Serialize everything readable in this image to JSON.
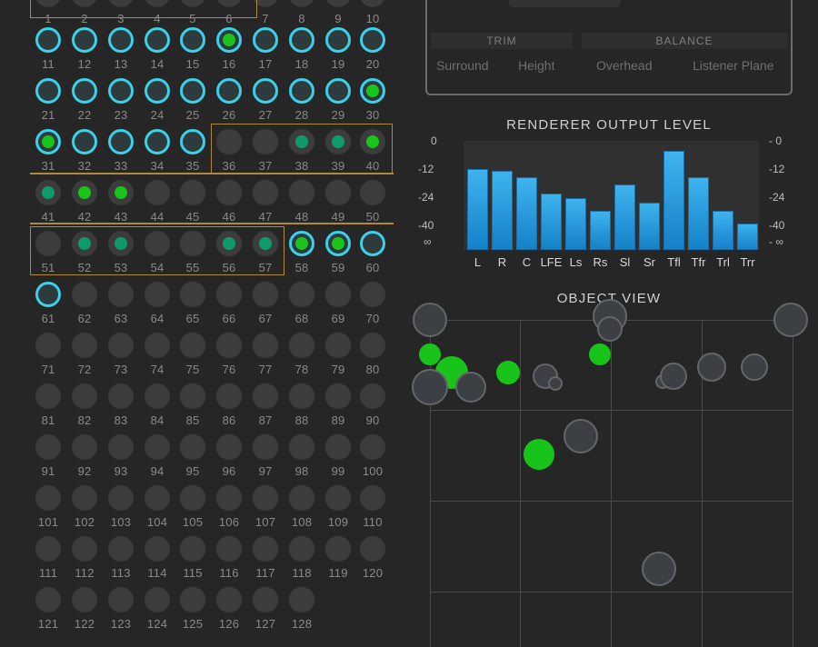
{
  "objects": [
    {
      "n": "1",
      "state": "gray"
    },
    {
      "n": "2",
      "state": "gray"
    },
    {
      "n": "3",
      "state": "gray"
    },
    {
      "n": "4",
      "state": "gray"
    },
    {
      "n": "5",
      "state": "gray"
    },
    {
      "n": "6",
      "state": "gray"
    },
    {
      "n": "7",
      "state": "gray"
    },
    {
      "n": "8",
      "state": "gray"
    },
    {
      "n": "9",
      "state": "gray"
    },
    {
      "n": "10",
      "state": "gray"
    },
    {
      "n": "11",
      "state": "cyan"
    },
    {
      "n": "12",
      "state": "cyan"
    },
    {
      "n": "13",
      "state": "cyan"
    },
    {
      "n": "14",
      "state": "cyan"
    },
    {
      "n": "15",
      "state": "cyan"
    },
    {
      "n": "16",
      "state": "cyan-green"
    },
    {
      "n": "17",
      "state": "cyan"
    },
    {
      "n": "18",
      "state": "cyan"
    },
    {
      "n": "19",
      "state": "cyan"
    },
    {
      "n": "20",
      "state": "cyan"
    },
    {
      "n": "21",
      "state": "cyan"
    },
    {
      "n": "22",
      "state": "cyan"
    },
    {
      "n": "23",
      "state": "cyan"
    },
    {
      "n": "24",
      "state": "cyan"
    },
    {
      "n": "25",
      "state": "cyan"
    },
    {
      "n": "26",
      "state": "cyan"
    },
    {
      "n": "27",
      "state": "cyan"
    },
    {
      "n": "28",
      "state": "cyan"
    },
    {
      "n": "29",
      "state": "cyan"
    },
    {
      "n": "30",
      "state": "cyan-green"
    },
    {
      "n": "31",
      "state": "cyan-green"
    },
    {
      "n": "32",
      "state": "cyan"
    },
    {
      "n": "33",
      "state": "cyan"
    },
    {
      "n": "34",
      "state": "cyan"
    },
    {
      "n": "35",
      "state": "cyan"
    },
    {
      "n": "36",
      "state": "gray"
    },
    {
      "n": "37",
      "state": "gray"
    },
    {
      "n": "38",
      "state": "teal"
    },
    {
      "n": "39",
      "state": "teal"
    },
    {
      "n": "40",
      "state": "green"
    },
    {
      "n": "41",
      "state": "teal"
    },
    {
      "n": "42",
      "state": "green"
    },
    {
      "n": "43",
      "state": "green"
    },
    {
      "n": "44",
      "state": "gray"
    },
    {
      "n": "45",
      "state": "gray"
    },
    {
      "n": "46",
      "state": "gray"
    },
    {
      "n": "47",
      "state": "gray"
    },
    {
      "n": "48",
      "state": "gray"
    },
    {
      "n": "49",
      "state": "gray"
    },
    {
      "n": "50",
      "state": "gray"
    },
    {
      "n": "51",
      "state": "gray"
    },
    {
      "n": "52",
      "state": "teal"
    },
    {
      "n": "53",
      "state": "teal"
    },
    {
      "n": "54",
      "state": "gray"
    },
    {
      "n": "55",
      "state": "gray"
    },
    {
      "n": "56",
      "state": "teal"
    },
    {
      "n": "57",
      "state": "teal"
    },
    {
      "n": "58",
      "state": "cyan-green"
    },
    {
      "n": "59",
      "state": "cyan-green"
    },
    {
      "n": "60",
      "state": "cyan"
    },
    {
      "n": "61",
      "state": "cyan"
    },
    {
      "n": "62",
      "state": "gray"
    },
    {
      "n": "63",
      "state": "gray"
    },
    {
      "n": "64",
      "state": "gray"
    },
    {
      "n": "65",
      "state": "gray"
    },
    {
      "n": "66",
      "state": "gray"
    },
    {
      "n": "67",
      "state": "gray"
    },
    {
      "n": "68",
      "state": "gray"
    },
    {
      "n": "69",
      "state": "gray"
    },
    {
      "n": "70",
      "state": "gray"
    },
    {
      "n": "71",
      "state": "gray"
    },
    {
      "n": "72",
      "state": "gray"
    },
    {
      "n": "73",
      "state": "gray"
    },
    {
      "n": "74",
      "state": "gray"
    },
    {
      "n": "75",
      "state": "gray"
    },
    {
      "n": "76",
      "state": "gray"
    },
    {
      "n": "77",
      "state": "gray"
    },
    {
      "n": "78",
      "state": "gray"
    },
    {
      "n": "79",
      "state": "gray"
    },
    {
      "n": "80",
      "state": "gray"
    },
    {
      "n": "81",
      "state": "gray"
    },
    {
      "n": "82",
      "state": "gray"
    },
    {
      "n": "83",
      "state": "gray"
    },
    {
      "n": "84",
      "state": "gray"
    },
    {
      "n": "85",
      "state": "gray"
    },
    {
      "n": "86",
      "state": "gray"
    },
    {
      "n": "87",
      "state": "gray"
    },
    {
      "n": "88",
      "state": "gray"
    },
    {
      "n": "89",
      "state": "gray"
    },
    {
      "n": "90",
      "state": "gray"
    },
    {
      "n": "91",
      "state": "gray"
    },
    {
      "n": "92",
      "state": "gray"
    },
    {
      "n": "93",
      "state": "gray"
    },
    {
      "n": "94",
      "state": "gray"
    },
    {
      "n": "95",
      "state": "gray"
    },
    {
      "n": "96",
      "state": "gray"
    },
    {
      "n": "97",
      "state": "gray"
    },
    {
      "n": "98",
      "state": "gray"
    },
    {
      "n": "99",
      "state": "gray"
    },
    {
      "n": "100",
      "state": "gray"
    },
    {
      "n": "101",
      "state": "gray"
    },
    {
      "n": "102",
      "state": "gray"
    },
    {
      "n": "103",
      "state": "gray"
    },
    {
      "n": "104",
      "state": "gray"
    },
    {
      "n": "105",
      "state": "gray"
    },
    {
      "n": "106",
      "state": "gray"
    },
    {
      "n": "107",
      "state": "gray"
    },
    {
      "n": "108",
      "state": "gray"
    },
    {
      "n": "109",
      "state": "gray"
    },
    {
      "n": "110",
      "state": "gray"
    },
    {
      "n": "111",
      "state": "gray"
    },
    {
      "n": "112",
      "state": "gray"
    },
    {
      "n": "113",
      "state": "gray"
    },
    {
      "n": "114",
      "state": "gray"
    },
    {
      "n": "115",
      "state": "gray"
    },
    {
      "n": "116",
      "state": "gray"
    },
    {
      "n": "117",
      "state": "gray"
    },
    {
      "n": "118",
      "state": "gray"
    },
    {
      "n": "119",
      "state": "gray"
    },
    {
      "n": "120",
      "state": "gray"
    },
    {
      "n": "121",
      "state": "gray"
    },
    {
      "n": "122",
      "state": "gray"
    },
    {
      "n": "123",
      "state": "gray"
    },
    {
      "n": "124",
      "state": "gray"
    },
    {
      "n": "125",
      "state": "gray"
    },
    {
      "n": "126",
      "state": "gray"
    },
    {
      "n": "127",
      "state": "gray"
    },
    {
      "n": "128",
      "state": "gray"
    }
  ],
  "trim_panel": {
    "trim_header": "TRIM",
    "balance_header": "BALANCE",
    "surround": "Surround",
    "height": "Height",
    "overhead": "Overhead",
    "listener_plane": "Listener Plane"
  },
  "meter": {
    "title": "RENDERER OUTPUT LEVEL",
    "tick_labels": [
      "0",
      "-12",
      "-24",
      "-40",
      "∞"
    ],
    "channels": [
      {
        "label": "L",
        "level": 0.78
      },
      {
        "label": "R",
        "level": 0.76
      },
      {
        "label": "C",
        "level": 0.7
      },
      {
        "label": "LFE",
        "level": 0.54
      },
      {
        "label": "Ls",
        "level": 0.5
      },
      {
        "label": "Rs",
        "level": 0.38
      },
      {
        "label": "Sl",
        "level": 0.63
      },
      {
        "label": "Sr",
        "level": 0.46
      },
      {
        "label": "Tfl",
        "level": 0.96
      },
      {
        "label": "Tfr",
        "level": 0.7
      },
      {
        "label": "Trl",
        "level": 0.38
      },
      {
        "label": "Trr",
        "level": 0.25
      }
    ]
  },
  "object_view": {
    "title": "OBJECT VIEW"
  },
  "colors": {
    "accent_cyan": "#3ad1ea",
    "active_green": "#19c51a",
    "teal": "#0f9a6b",
    "group_gold": "#b08a3a",
    "meter_blue": "#2b9be0"
  }
}
